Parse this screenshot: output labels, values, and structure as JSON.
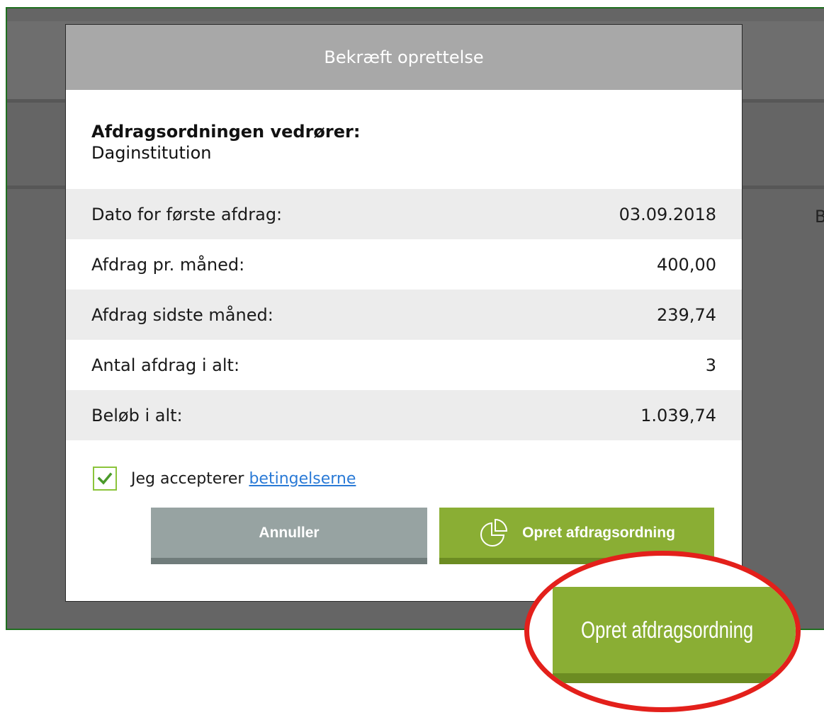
{
  "modal": {
    "title": "Bekræft oprettelse",
    "intro_label": "Afdragsordningen vedrører:",
    "intro_value": "Daginstitution",
    "rows": [
      {
        "label": "Dato for første afdrag:",
        "value": "03.09.2018"
      },
      {
        "label": "Afdrag pr. måned:",
        "value": "400,00"
      },
      {
        "label": "Afdrag sidste måned:",
        "value": "239,74"
      },
      {
        "label": "Antal afdrag i alt:",
        "value": "3"
      },
      {
        "label": "Beløb i alt:",
        "value": "1.039,74"
      }
    ],
    "accept_text": "Jeg accepterer",
    "accept_link": "betingelserne",
    "accept_checked": true,
    "cancel_label": "Annuller",
    "create_label": "Opret afdragsordning"
  },
  "background": {
    "edge_letter": "B"
  },
  "callout": {
    "label": "Opret afdragsordning",
    "ring_color": "#e3201b"
  },
  "colors": {
    "accent_green": "#8aae34",
    "cancel_gray": "#97a3a2",
    "header_gray": "#a8a8a8",
    "link_blue": "#2a7ad6"
  },
  "icons": {
    "create": "pie-chart-icon",
    "checkbox": "checkmark-icon"
  }
}
